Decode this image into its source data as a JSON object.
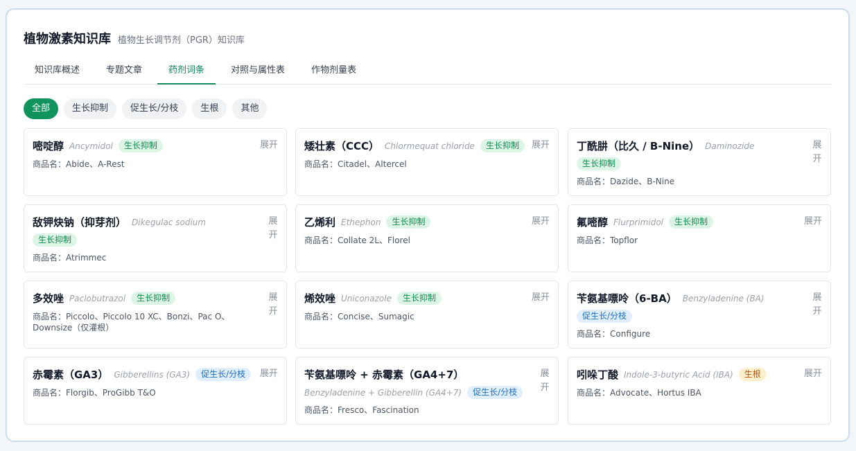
{
  "header": {
    "title": "植物激素知识库",
    "subtitle": "植物生长调节剂（PGR）知识库"
  },
  "tabs": [
    {
      "label": "知识库概述",
      "active": false
    },
    {
      "label": "专题文章",
      "active": false
    },
    {
      "label": "药剂词条",
      "active": true
    },
    {
      "label": "对照与属性表",
      "active": false
    },
    {
      "label": "作物剂量表",
      "active": false
    }
  ],
  "filters": [
    {
      "label": "全部",
      "active": true
    },
    {
      "label": "生长抑制",
      "active": false
    },
    {
      "label": "促生长/分枝",
      "active": false
    },
    {
      "label": "生根",
      "active": false
    },
    {
      "label": "其他",
      "active": false
    }
  ],
  "expand_label": "展开",
  "colors": {
    "accent": "#11935d",
    "tab_active": "#0d8a57",
    "badge_inhibit_bg": "#dcf5e6",
    "badge_promote_bg": "#e1eefb",
    "badge_root_bg": "#fdf0cf"
  },
  "cards": [
    {
      "name": "嘧啶醇",
      "latin": "Ancymidol",
      "badge": "生长抑制",
      "badge_type": "inhibit",
      "trade": "商品名：Abide、A-Rest"
    },
    {
      "name": "矮壮素（CCC）",
      "latin": "Chlormequat chloride",
      "badge": "生长抑制",
      "badge_type": "inhibit",
      "trade": "商品名：Citadel、Altercel"
    },
    {
      "name": "丁酰肼（比久 / B-Nine）",
      "latin": "Daminozide",
      "badge": "生长抑制",
      "badge_type": "inhibit",
      "trade": "商品名：Dazide、B-Nine"
    },
    {
      "name": "敌钾炔钠（抑芽剂）",
      "latin": "Dikegulac sodium",
      "badge": "生长抑制",
      "badge_type": "inhibit",
      "trade": "商品名：Atrimmec"
    },
    {
      "name": "乙烯利",
      "latin": "Ethephon",
      "badge": "生长抑制",
      "badge_type": "inhibit",
      "trade": "商品名：Collate 2L、Florel"
    },
    {
      "name": "氟嘧醇",
      "latin": "Flurprimidol",
      "badge": "生长抑制",
      "badge_type": "inhibit",
      "trade": "商品名：Topflor"
    },
    {
      "name": "多效唑",
      "latin": "Paclobutrazol",
      "badge": "生长抑制",
      "badge_type": "inhibit",
      "trade": "商品名：Piccolo、Piccolo 10 XC、Bonzi、Pac O、Downsize（仅灌根）"
    },
    {
      "name": "烯效唑",
      "latin": "Uniconazole",
      "badge": "生长抑制",
      "badge_type": "inhibit",
      "trade": "商品名：Concise、Sumagic"
    },
    {
      "name": "苄氨基嘌呤（6-BA）",
      "latin": "Benzyladenine (BA)",
      "badge": "促生长/分枝",
      "badge_type": "promote",
      "trade": "商品名：Configure"
    },
    {
      "name": "赤霉素（GA3）",
      "latin": "Gibberellins (GA3)",
      "badge": "促生长/分枝",
      "badge_type": "promote",
      "trade": "商品名：Florgib、ProGibb T&O"
    },
    {
      "name": "苄氨基嘌呤 + 赤霉素（GA4+7）",
      "latin": "Benzyladenine + Gibberellin (GA4+7)",
      "badge": "促生长/分枝",
      "badge_type": "promote",
      "trade": "商品名：Fresco、Fascination"
    },
    {
      "name": "吲哚丁酸",
      "latin": "Indole-3-butyric Acid (IBA)",
      "badge": "生根",
      "badge_type": "root",
      "trade": "商品名：Advocate、Hortus IBA"
    }
  ]
}
